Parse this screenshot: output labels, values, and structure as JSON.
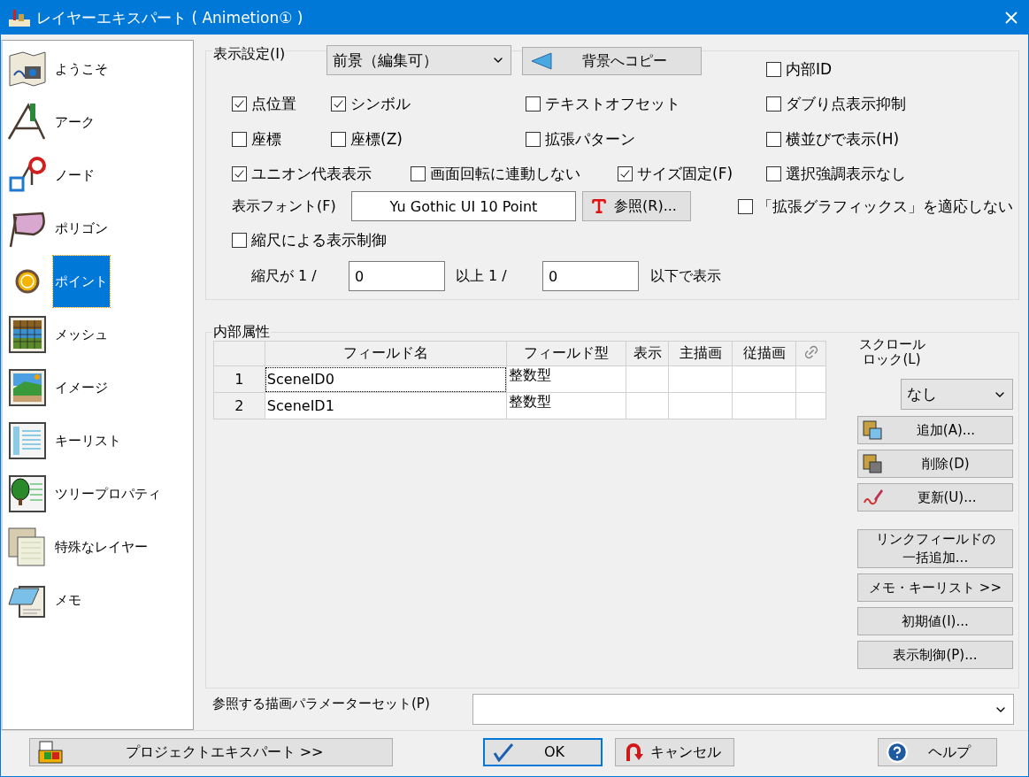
{
  "window": {
    "title": "レイヤーエキスパート ( Animetion① )"
  },
  "sidebar": {
    "items": [
      {
        "label": "ようこそ",
        "selected": false
      },
      {
        "label": "アーク",
        "selected": false
      },
      {
        "label": "ノード",
        "selected": false
      },
      {
        "label": "ポリゴン",
        "selected": false
      },
      {
        "label": "ポイント",
        "selected": true
      },
      {
        "label": "メッシュ",
        "selected": false
      },
      {
        "label": "イメージ",
        "selected": false
      },
      {
        "label": "キーリスト",
        "selected": false
      },
      {
        "label": "ツリープロパティ",
        "selected": false
      },
      {
        "label": "特殊なレイヤー",
        "selected": false
      },
      {
        "label": "メモ",
        "selected": false
      }
    ]
  },
  "display_settings": {
    "legend": "表示設定(I)",
    "mode_select": {
      "value": "前景（編集可）"
    },
    "copy_button": "背景へコピー",
    "internal_id": {
      "label": "内部ID",
      "checked": false
    },
    "checkbox_rows": [
      {
        "checkboxes": [
          {
            "label": "点位置",
            "checked": true
          },
          {
            "label": "シンボル",
            "checked": true
          },
          {
            "label": "テキストオフセット",
            "checked": false
          },
          {
            "label": "ダブり点表示抑制",
            "checked": false
          }
        ]
      },
      {
        "checkboxes": [
          {
            "label": "座標",
            "checked": false
          },
          {
            "label": "座標(Z)",
            "checked": false
          },
          {
            "label": "拡張パターン",
            "checked": false
          },
          {
            "label": "横並びで表示(H)",
            "checked": false
          }
        ]
      },
      {
        "checkboxes": [
          {
            "label": "ユニオン代表表示",
            "checked": true
          },
          {
            "label": "画面回転に連動しない",
            "checked": false
          },
          {
            "label": "サイズ固定(F)",
            "checked": true
          },
          {
            "label": "選択強調表示なし",
            "checked": false
          }
        ]
      }
    ],
    "font_label": "表示フォント(F)",
    "font_value": "Yu Gothic UI 10 Point",
    "browse_button": "参照(R)...",
    "extended_graphics": {
      "label": "「拡張グラフィックス」を適応しない",
      "checked": false
    },
    "scale_control": {
      "label": "縮尺による表示制御",
      "checked": false
    },
    "scale_row": {
      "prefix": "縮尺が 1 /",
      "min_value": "0",
      "middle": "以上 1 /",
      "max_value": "0",
      "suffix": "以下で表示"
    }
  },
  "internal_attributes": {
    "legend": "内部属性",
    "table": {
      "columns": [
        "フィールド名",
        "フィールド型",
        "表示",
        "主描画",
        "従描画"
      ],
      "rows": [
        {
          "number": "1",
          "name": "SceneID0",
          "type": "整数型",
          "focused": true
        },
        {
          "number": "2",
          "name": "SceneID1",
          "type": "整数型",
          "focused": false
        }
      ]
    },
    "scroll_lock_label": "スクロールロック(L)",
    "scroll_lock_select": {
      "value": "なし"
    },
    "buttons": [
      {
        "label": "追加(A)...",
        "kind": "add"
      },
      {
        "label": "削除(D)",
        "kind": "delete"
      },
      {
        "label": "更新(U)...",
        "kind": "update"
      },
      {
        "label": "リンクフィールドの一括追加...",
        "kind": "plain"
      },
      {
        "label": "メモ・キーリスト >>",
        "kind": "plain"
      },
      {
        "label": "初期値(I)...",
        "kind": "plain"
      },
      {
        "label": "表示制御(P)...",
        "kind": "plain"
      }
    ]
  },
  "parameter_set": {
    "label": "参照する描画パラメーターセット(P)"
  },
  "footer": {
    "buttons": [
      {
        "label": "プロジェクトエキスパート >>",
        "kind": "project"
      },
      {
        "label": "OK",
        "kind": "ok"
      },
      {
        "label": "キャンセル",
        "kind": "cancel"
      },
      {
        "label": "ヘルプ",
        "kind": "help"
      }
    ]
  }
}
